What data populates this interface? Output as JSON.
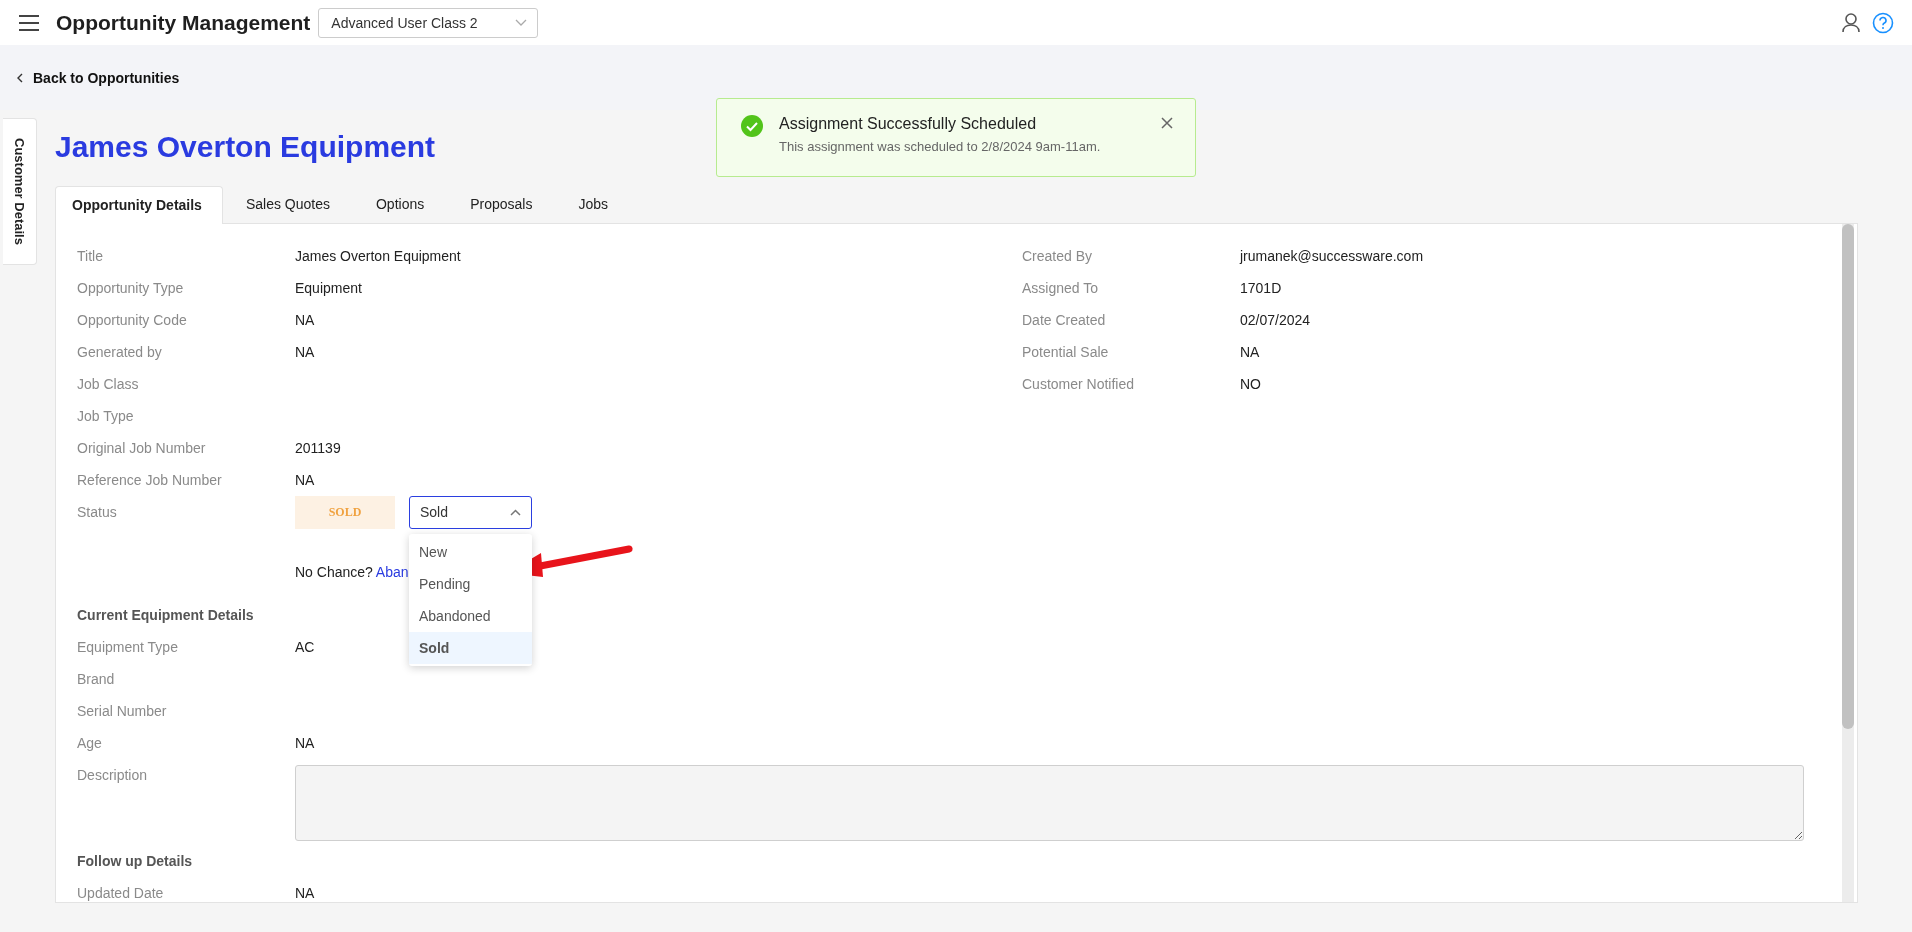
{
  "header": {
    "title": "Opportunity Management",
    "class_select": "Advanced User Class 2"
  },
  "back_link": "Back to Opportunities",
  "side_tab": "Customer Details",
  "page_title": "James Overton Equipment",
  "toast": {
    "title": "Assignment Successfully Scheduled",
    "message": "This assignment was scheduled to 2/8/2024 9am-11am."
  },
  "tabs": [
    {
      "label": "Opportunity Details",
      "selected": true
    },
    {
      "label": "Sales Quotes",
      "selected": false
    },
    {
      "label": "Options",
      "selected": false
    },
    {
      "label": "Proposals",
      "selected": false
    },
    {
      "label": "Jobs",
      "selected": false
    }
  ],
  "details_left": [
    {
      "label": "Title",
      "value": "James Overton Equipment"
    },
    {
      "label": "Opportunity Type",
      "value": "Equipment"
    },
    {
      "label": "Opportunity Code",
      "value": "NA"
    },
    {
      "label": "Generated by",
      "value": "NA"
    },
    {
      "label": "Job Class"
    },
    {
      "label": "Job Type"
    },
    {
      "label": "Original Job Number",
      "value": "201139"
    },
    {
      "label": "Reference Job Number",
      "value": "NA"
    }
  ],
  "status": {
    "label": "Status",
    "badge": "SOLD",
    "select_value": "Sold",
    "expanded": true,
    "options": [
      {
        "label": "New",
        "selected": false
      },
      {
        "label": "Pending",
        "selected": false
      },
      {
        "label": "Abandoned",
        "selected": false
      },
      {
        "label": "Sold",
        "selected": true
      }
    ],
    "no_chance": "No Chance?",
    "abandon_link": "Aban"
  },
  "details_right": [
    {
      "label": "Created By",
      "value": "jrumanek@successware.com"
    },
    {
      "label": "Assigned To",
      "value": "1701D"
    },
    {
      "label": "Date Created",
      "value": "02/07/2024"
    },
    {
      "label": "Potential Sale",
      "value": "NA"
    },
    {
      "label": "Customer Notified",
      "value": "NO"
    }
  ],
  "equipment": {
    "heading": "Current Equipment Details",
    "rows": [
      {
        "label": "Equipment Type",
        "value": "AC"
      },
      {
        "label": "Brand"
      },
      {
        "label": "Serial Number"
      },
      {
        "label": "Age",
        "value": "NA"
      }
    ],
    "description_label": "Description"
  },
  "follow_up": {
    "heading": "Follow up Details",
    "rows": [
      {
        "label": "Updated Date",
        "value": "NA"
      }
    ]
  }
}
